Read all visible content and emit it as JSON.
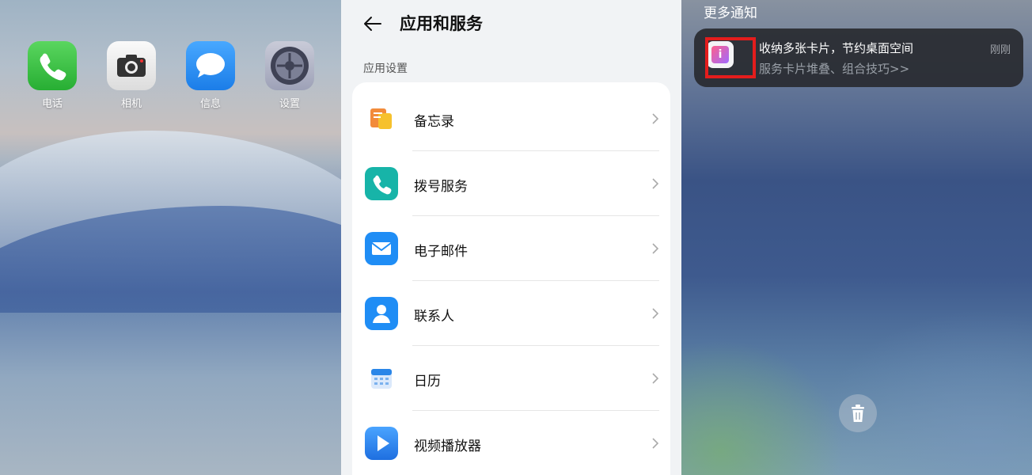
{
  "home": {
    "apps": [
      {
        "label": "电话",
        "icon": "phone-icon"
      },
      {
        "label": "相机",
        "icon": "camera-icon"
      },
      {
        "label": "信息",
        "icon": "message-icon"
      },
      {
        "label": "设置",
        "icon": "settings-icon"
      }
    ]
  },
  "settings": {
    "title": "应用和服务",
    "section": "应用设置",
    "items": [
      {
        "label": "备忘录",
        "icon": "notes-icon"
      },
      {
        "label": "拨号服务",
        "icon": "dialer-icon"
      },
      {
        "label": "电子邮件",
        "icon": "email-icon"
      },
      {
        "label": "联系人",
        "icon": "contacts-icon"
      },
      {
        "label": "日历",
        "icon": "calendar-icon"
      },
      {
        "label": "视频播放器",
        "icon": "video-player-icon"
      }
    ]
  },
  "notifications": {
    "header": "更多通知",
    "card": {
      "title": "收纳多张卡片，节约桌面空间",
      "subtitle": "服务卡片堆叠、组合技巧>>",
      "time": "刚刚",
      "icon_glyph": "i"
    }
  },
  "colors": {
    "highlight": "#e41d1d"
  }
}
